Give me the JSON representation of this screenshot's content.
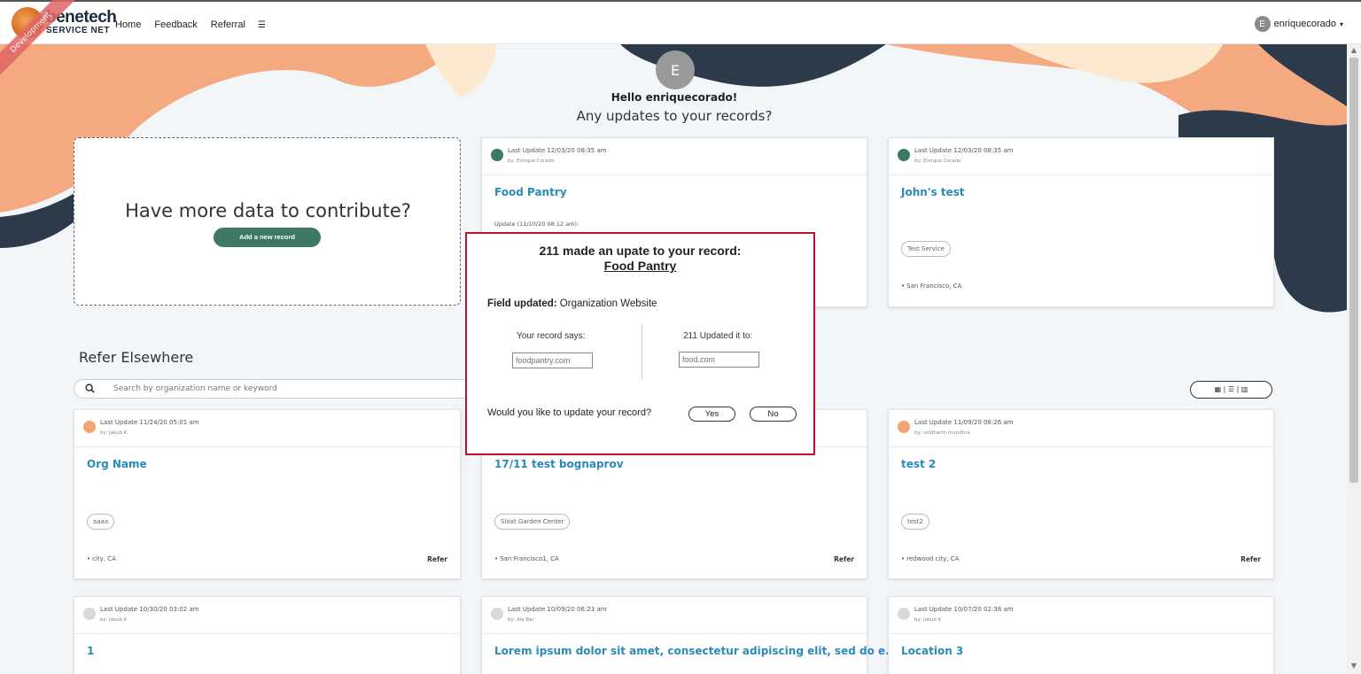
{
  "nav": {
    "logo_main": "benetech",
    "logo_sub": "SERVICE NET",
    "ribbon": "Development",
    "links": [
      "Home",
      "Feedback",
      "Referral"
    ],
    "user_initial": "E",
    "username": "enriquecorado"
  },
  "hello": {
    "initial": "E",
    "greeting": "Hello enriquecorado!",
    "question": "Any updates to your records?"
  },
  "contribute": {
    "title": "Have more data to contribute?",
    "button": "Add a new record"
  },
  "my_records": [
    {
      "last_update": "Last Update 12/03/20 08:35 am",
      "by": "by: Enrique Corado",
      "title": "Food Pantry",
      "update": "Update (11/10/20 08:12 am):",
      "dot": "#3e7a63"
    },
    {
      "last_update": "Last Update 12/03/20 08:35 am",
      "by": "by: Enrique Corado",
      "title": "John's test",
      "tag": "Test Service",
      "location": "San Francisco, CA",
      "dot": "#3e7a63"
    }
  ],
  "refer": {
    "title": "Refer Elsewhere",
    "search_placeholder": "Search by organization name or keyword",
    "view_toggle": "▦ | ☰ | ▥",
    "refer_label": "Refer"
  },
  "refer_cards": [
    {
      "last_update": "Last Update 11/24/20 05:01 am",
      "by": "by: Jakub K",
      "title": "Org Name",
      "tag": "aaaa",
      "location": "city, CA",
      "dot": "#f4a373"
    },
    {
      "last_update": "",
      "by": "",
      "title": "17/11 test bognaprov",
      "tag": "Sloat Garden Center",
      "location": "San Francisco1, CA",
      "dot": "#f4a373"
    },
    {
      "last_update": "Last Update 11/09/20 08:26 am",
      "by": "by: siddharth mundhra",
      "title": "test 2",
      "tag": "test2",
      "location": "redwood city, CA",
      "dot": "#f4a373"
    },
    {
      "last_update": "Last Update 10/30/20 03:02 am",
      "by": "by: Jakub K",
      "title": "1",
      "dot": "#d9d9d9"
    },
    {
      "last_update": "Last Update 10/09/20 06:23 am",
      "by": "by: Ala Bar",
      "title": "Lorem ipsum dolor sit amet, consectetur adipiscing elit, sed do e...",
      "dot": "#d9d9d9"
    },
    {
      "last_update": "Last Update 10/07/20 02:38 am",
      "by": "by: Jakub K",
      "title": "Location 3",
      "dot": "#d9d9d9"
    }
  ],
  "modal": {
    "title": "211 made an upate to your record:",
    "record": "Food Pantry",
    "field_label": "Field updated:",
    "field_value": "Organization Website",
    "left_label": "Your record says:",
    "left_value": "foodpantry.com",
    "right_label": "211 Updated it to:",
    "right_value": "food.com",
    "question": "Would you like to update your record?",
    "yes": "Yes",
    "no": "No"
  },
  "colors": {
    "accent": "#2a8bb8",
    "button_green": "#3e7a63",
    "modal_border": "#c0102b",
    "bg_navy": "#2d3a4a",
    "bg_peach": "#f5a981",
    "bg_cream": "#fde9cf"
  }
}
